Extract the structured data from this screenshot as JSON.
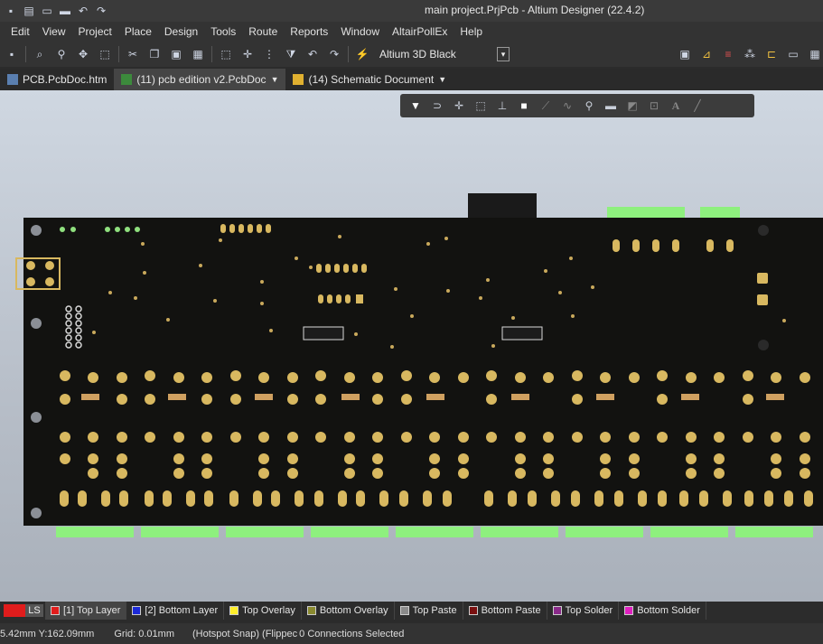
{
  "window": {
    "title": "main project.PrjPcb - Altium Designer (22.4.2)"
  },
  "quick_access": [
    "save-icon",
    "save-all-icon",
    "open-icon",
    "open-project-icon",
    "undo-icon",
    "redo-icon"
  ],
  "menu": [
    "Edit",
    "View",
    "Project",
    "Place",
    "Design",
    "Tools",
    "Route",
    "Reports",
    "Window",
    "AltairPollEx",
    "Help"
  ],
  "toolbar": {
    "view_config": "Altium 3D Black"
  },
  "tabs": [
    {
      "label": "PCB.PcbDoc.htm",
      "active": false
    },
    {
      "label": "(11) pcb edition v2.PcbDoc",
      "active": true
    },
    {
      "label": "(14) Schematic Document",
      "active": false
    }
  ],
  "layers": {
    "ls": "LS",
    "items": [
      {
        "label": "[1] Top Layer",
        "color": "#e01c1c",
        "active": true
      },
      {
        "label": "[2] Bottom Layer",
        "color": "#1c2ad8",
        "active": false
      },
      {
        "label": "Top Overlay",
        "color": "#ffee2a",
        "active": false
      },
      {
        "label": "Bottom Overlay",
        "color": "#8a8a30",
        "active": false
      },
      {
        "label": "Top Paste",
        "color": "#8a8a8a",
        "active": false
      },
      {
        "label": "Bottom Paste",
        "color": "#7a1010",
        "active": false
      },
      {
        "label": "Top Solder",
        "color": "#8a2a8a",
        "active": false
      },
      {
        "label": "Bottom Solder",
        "color": "#e020c0",
        "active": false
      }
    ]
  },
  "status": {
    "coords": "5.42mm Y:162.09mm",
    "grid": "Grid: 0.01mm",
    "snap": "(Hotspot Snap) (Flippec",
    "connections": "0 Connections Selected"
  },
  "colors": {
    "pcb_board": "#121210",
    "pad": "#c8a85a",
    "edge_connector": "#8ef07e",
    "canvas_bg": "#c5ccd6"
  }
}
